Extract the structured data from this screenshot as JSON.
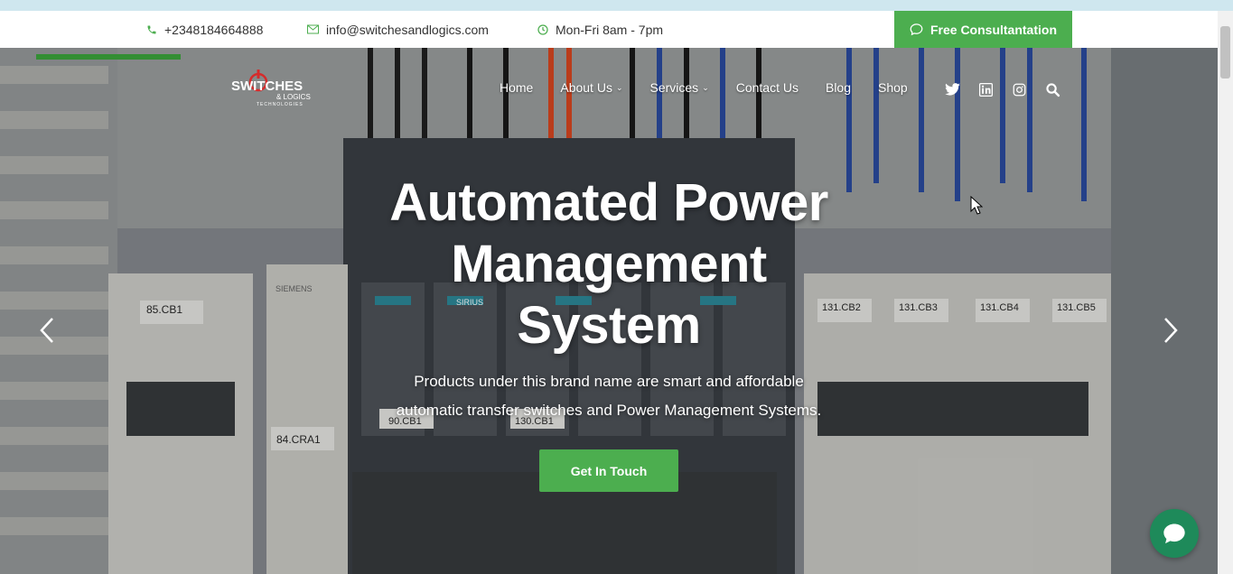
{
  "topbar": {
    "phone": "+2348184664888",
    "email": "info@switchesandlogics.com",
    "hours": "Mon-Fri 8am - 7pm",
    "consult_label": "Free Consultantation"
  },
  "logo": {
    "text_main": "SWITCHES",
    "text_sub": "& LOGICS",
    "text_tag": "TECHNOLOGIES"
  },
  "nav": {
    "items": [
      {
        "label": "Home"
      },
      {
        "label": "About Us"
      },
      {
        "label": "Services"
      },
      {
        "label": "Contact Us"
      },
      {
        "label": "Blog"
      },
      {
        "label": "Shop"
      }
    ]
  },
  "social": {
    "icons": [
      "twitter-icon",
      "linkedin-icon",
      "instagram-icon",
      "search-icon"
    ]
  },
  "hero": {
    "title_line1": "Automated Power",
    "title_line2": "Management",
    "title_line3": "System",
    "subtitle_line1": "Products under this brand name are smart and affordable",
    "subtitle_line2": "automatic transfer switches and Power Management Systems.",
    "cta_label": "Get In Touch",
    "breaker_labels": [
      "85.CB1",
      "84.CRA1",
      "90.CB1",
      "130.CB1",
      "131.CB2",
      "131.CB3",
      "131.CB4",
      "131.CB5",
      "SIEMENS",
      "SIRIUS"
    ]
  },
  "colors": {
    "accent": "#4cae4f",
    "chat": "#1e8a5a"
  }
}
